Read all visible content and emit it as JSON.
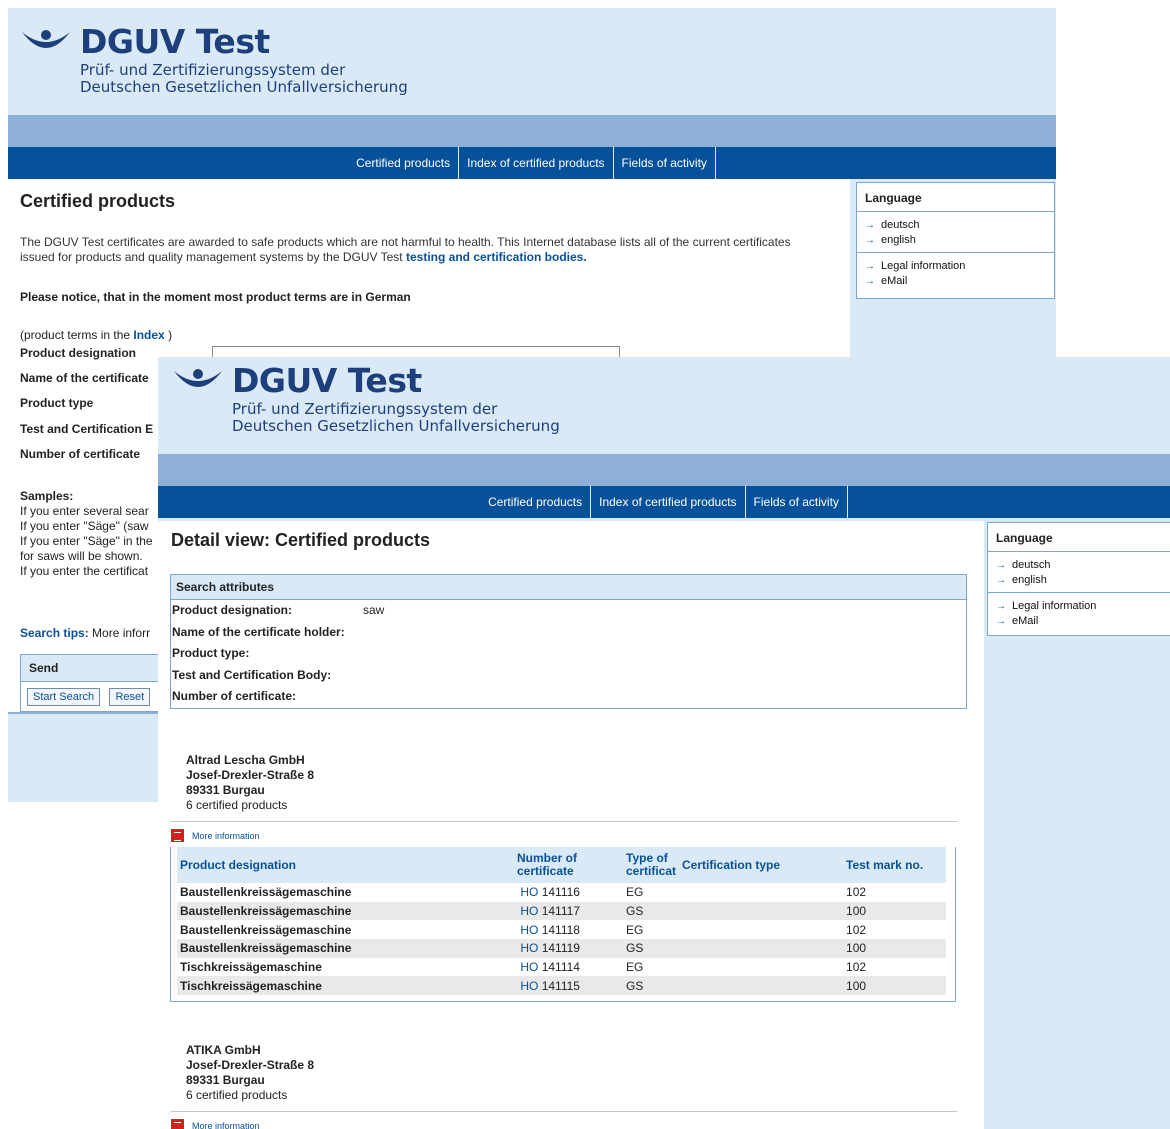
{
  "brand": {
    "title": "DGUV Test",
    "subtitle_line1": "Prüf- und Zertifizierungssystem der",
    "subtitle_line2": "Deutschen Gesetzlichen Unfallversicherung",
    "colors": {
      "navy": "#07519a",
      "light_blue": "#dae9f6",
      "band": "#8fb0d6"
    }
  },
  "nav": [
    "Certified products",
    "Index of certified products",
    "Fields of activity"
  ],
  "sidebar": {
    "title": "Language",
    "languages": [
      "deutsch",
      "english"
    ],
    "links": [
      "Legal information",
      "eMail"
    ]
  },
  "search_page": {
    "title": "Certified products",
    "intro": "The DGUV Test certificates are awarded to safe products which are not harmful to health. This Internet database lists all of the current certificates issued for products and quality management systems by the DGUV Test",
    "intro_link": "testing and certification bodies.",
    "notice": "Please notice, that in the moment most product terms are in German",
    "index_prefix": "(product terms in the",
    "index_link": "Index",
    "index_suffix": ")",
    "labels": [
      "Product designation",
      "Name of the certificate",
      "Product type",
      "Test and Certification E",
      "Number of certificate"
    ],
    "samples_title": "Samples:",
    "samples_lines": [
      "If you enter several sear",
      "If you enter \"Säge\" (saw",
      "If you enter \"Säge\" in the",
      "for saws will be shown.",
      "If you enter the certificat"
    ],
    "tips_label": "Search tips:",
    "tips_text": "More inforr",
    "send_title": "Send",
    "start_button": "Start Search",
    "reset_button": "Reset"
  },
  "detail_page": {
    "title": "Detail view: Certified products",
    "attributes_title": "Search attributes",
    "attributes": [
      {
        "label": "Product designation:",
        "value": "saw"
      },
      {
        "label": "Name of the certificate holder:",
        "value": ""
      },
      {
        "label": "Product type:",
        "value": ""
      },
      {
        "label": "Test and Certification Body:",
        "value": ""
      },
      {
        "label": "Number of certificate:",
        "value": ""
      }
    ],
    "more_info": "More information",
    "columns": [
      "Product designation",
      "Number of certificate",
      "Type of certificat",
      "Certification type",
      "Test mark no."
    ],
    "companies": [
      {
        "name": "Altrad Lescha GmbH",
        "street": "Josef-Drexler-Straße 8",
        "city": "89331 Burgau",
        "count": "6 certified products",
        "rows": [
          {
            "designation": "Baustellenkreissägemaschine",
            "prefix": "HO",
            "number": "141116",
            "type": "EG",
            "cert_type": "",
            "mark": "102"
          },
          {
            "designation": "Baustellenkreissägemaschine",
            "prefix": "HO",
            "number": "141117",
            "type": "GS",
            "cert_type": "",
            "mark": "100"
          },
          {
            "designation": "Baustellenkreissägemaschine",
            "prefix": "HO",
            "number": "141118",
            "type": "EG",
            "cert_type": "",
            "mark": "102"
          },
          {
            "designation": "Baustellenkreissägemaschine",
            "prefix": "HO",
            "number": "141119",
            "type": "GS",
            "cert_type": "",
            "mark": "100"
          },
          {
            "designation": "Tischkreissägemaschine",
            "prefix": "HO",
            "number": "141114",
            "type": "EG",
            "cert_type": "",
            "mark": "102"
          },
          {
            "designation": "Tischkreissägemaschine",
            "prefix": "HO",
            "number": "141115",
            "type": "GS",
            "cert_type": "",
            "mark": "100"
          }
        ]
      },
      {
        "name": "ATIKA GmbH",
        "street": "Josef-Drexler-Straße 8",
        "city": "89331 Burgau",
        "count": "6 certified products",
        "rows": []
      }
    ]
  }
}
